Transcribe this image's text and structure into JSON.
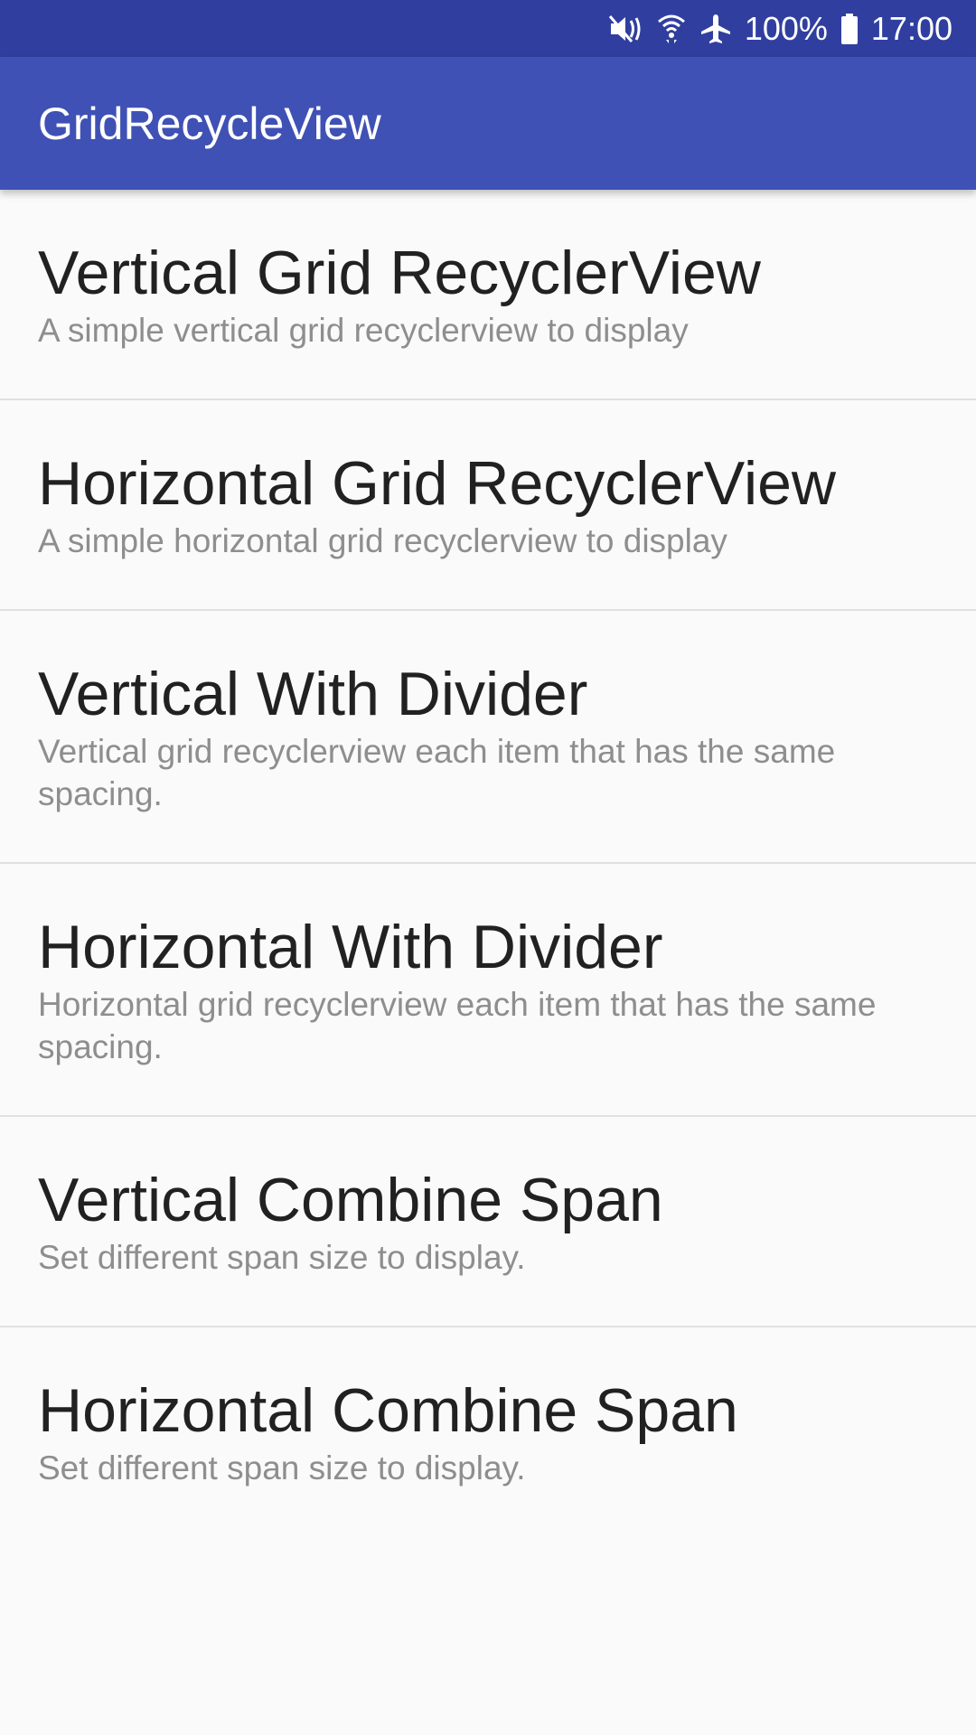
{
  "status_bar": {
    "battery": "100%",
    "time": "17:00",
    "icons": [
      "mute-vibrate-icon",
      "wifi-icon",
      "airplane-icon",
      "battery-icon"
    ]
  },
  "app_bar": {
    "title": "GridRecycleView"
  },
  "list": {
    "items": [
      {
        "title": "Vertical Grid RecyclerView",
        "subtitle": "A simple vertical grid recyclerview to display"
      },
      {
        "title": "Horizontal Grid RecyclerView",
        "subtitle": "A simple horizontal grid recyclerview to display"
      },
      {
        "title": "Vertical With Divider",
        "subtitle": "Vertical grid recyclerview each item that has the same spacing."
      },
      {
        "title": "Horizontal With Divider",
        "subtitle": "Horizontal grid recyclerview each item that has the same spacing."
      },
      {
        "title": "Vertical Combine Span",
        "subtitle": "Set different span size to display."
      },
      {
        "title": "Horizontal Combine Span",
        "subtitle": "Set different span size to display."
      }
    ]
  },
  "colors": {
    "status_bar": "#303f9f",
    "app_bar": "#3f51b5",
    "background": "#fafafa",
    "title_text": "#212121",
    "subtitle_text": "#8e8e8e",
    "divider": "#e0e0e0"
  }
}
